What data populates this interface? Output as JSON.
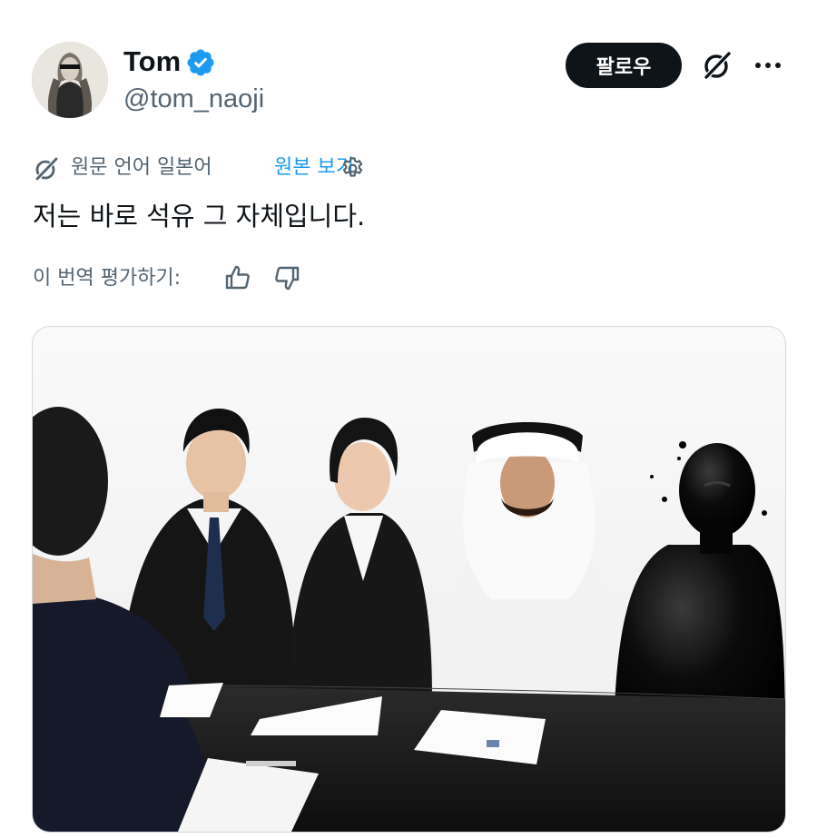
{
  "author": {
    "name": "Tom",
    "handle": "@tom_naoji",
    "verified": true
  },
  "actions": {
    "follow_label": "팔로우",
    "grok_icon": "grok-icon",
    "more_icon": "more-icon"
  },
  "translation": {
    "source_language_label": "원문 언어 일본어",
    "view_original_label": "원본 보기",
    "settings_icon": "gear-icon"
  },
  "tweet": {
    "text": "저는 바로 석유 그 자체입니다."
  },
  "rating": {
    "label": "이 번역 평가하기:",
    "thumbs_up_icon": "thumbs-up-icon",
    "thumbs_down_icon": "thumbs-down-icon"
  },
  "media": {
    "type": "image"
  },
  "colors": {
    "text_primary": "#0f1419",
    "text_secondary": "#536471",
    "link_blue": "#1d9bf0",
    "verified_blue": "#1d9bf0",
    "follow_bg": "#0f1419"
  }
}
